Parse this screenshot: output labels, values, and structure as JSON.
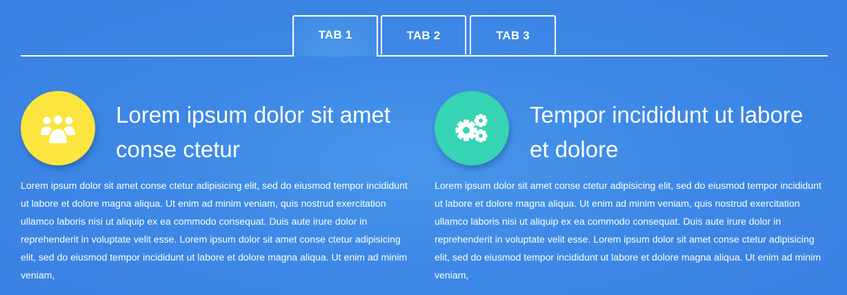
{
  "tabs": [
    {
      "label": "TAB 1",
      "active": true
    },
    {
      "label": "TAB 2",
      "active": false
    },
    {
      "label": "TAB 3",
      "active": false
    }
  ],
  "features": [
    {
      "icon": "users-group-icon",
      "icon_color": "#fce53e",
      "title": "Lorem ipsum dolor sit amet conse ctetur",
      "text": "Lorem ipsum dolor sit amet conse ctetur adipisicing elit, sed do eiusmod tempor incididunt ut labore et dolore magna aliqua. Ut enim ad minim veniam, quis nostrud exercitation ullamco laboris nisi ut aliquip ex ea commodo consequat. Duis aute irure dolor in reprehenderit in voluptate velit esse. Lorem ipsum dolor sit amet conse ctetur adipisicing elit, sed do eiusmod tempor incididunt ut labore et dolore magna aliqua. Ut enim ad minim veniam,"
    },
    {
      "icon": "gears-icon",
      "icon_color": "#36d4b4",
      "title": "Tempor incididunt ut labore et dolore",
      "text": "Lorem ipsum dolor sit amet conse ctetur adipisicing elit, sed do eiusmod tempor incididunt ut labore et dolore magna aliqua. Ut enim ad minim veniam, quis nostrud exercitation ullamco laboris nisi ut aliquip ex ea commodo consequat. Duis aute irure dolor in reprehenderit in voluptate velit esse. Lorem ipsum dolor sit amet conse ctetur adipisicing elit, sed do eiusmod tempor incididunt ut labore et dolore magna aliqua. Ut enim ad minim veniam,"
    }
  ],
  "colors": {
    "background": "#3d88e6",
    "accent_yellow": "#fce53e",
    "accent_teal": "#36d4b4",
    "text": "#ffffff"
  }
}
